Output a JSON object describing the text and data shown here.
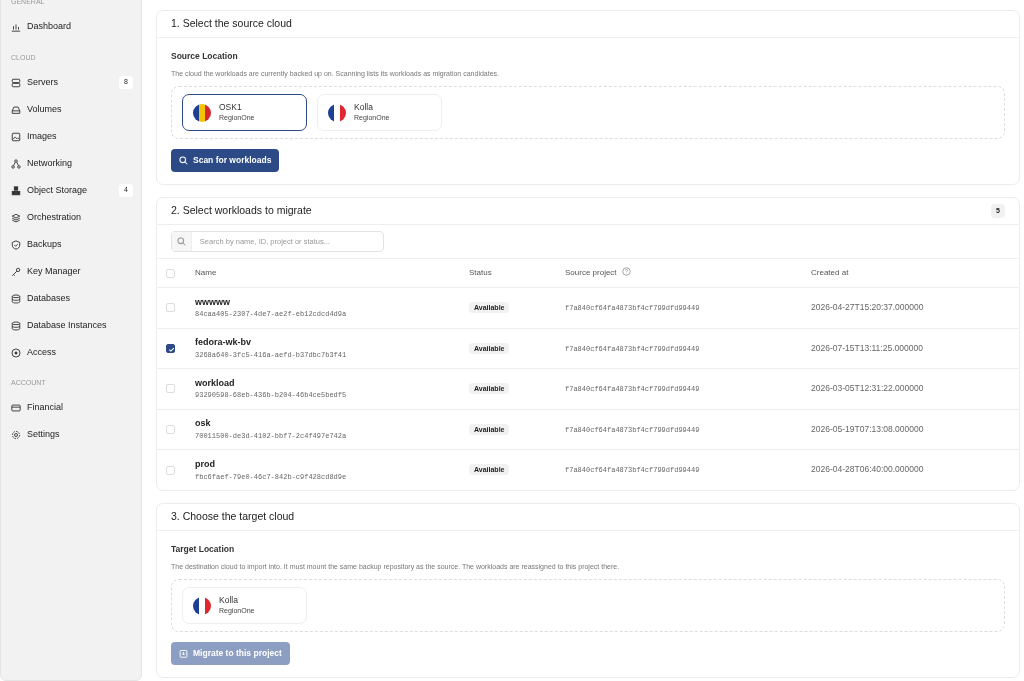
{
  "sidebar": {
    "sections": [
      {
        "title": "GENERAL",
        "items": [
          {
            "label": "Dashboard"
          }
        ]
      },
      {
        "title": "CLOUD",
        "items": [
          {
            "label": "Servers",
            "count": "8"
          },
          {
            "label": "Volumes"
          },
          {
            "label": "Images"
          },
          {
            "label": "Networking"
          },
          {
            "label": "Object Storage",
            "count": "4"
          },
          {
            "label": "Orchestration"
          },
          {
            "label": "Backups"
          },
          {
            "label": "Key Manager"
          },
          {
            "label": "Databases"
          },
          {
            "label": "Database Instances"
          },
          {
            "label": "Access"
          }
        ]
      },
      {
        "title": "ACCOUNT",
        "items": [
          {
            "label": "Financial"
          },
          {
            "label": "Settings"
          }
        ]
      }
    ]
  },
  "source": {
    "title": "1. Select the source cloud",
    "label": "Source Location",
    "help": "The cloud the workloads are currently backed up on. Scanning lists its workloads as migration candidates.",
    "locations": [
      {
        "name": "OSK1",
        "region": "RegionOne",
        "kind": "ro",
        "selected": true
      },
      {
        "name": "Kolla",
        "region": "RegionOne",
        "kind": "fr",
        "selected": false
      }
    ],
    "button": {
      "label": "Scan for workloads",
      "disabled": false
    }
  },
  "workloads": {
    "title": "2. Select workloads to migrate",
    "count": "5",
    "all_checked": false,
    "search": {
      "placeholder": "Search by name, ID, project or status..."
    },
    "columns": [
      "Name",
      "Status",
      "Source project",
      "Created at"
    ],
    "rows": [
      {
        "name": "wwwww",
        "id": "84caa405-2307-4de7-ae2f-eb12cdcd4d9a",
        "status": "Available",
        "project": "f7a840cf64fa4873bf4cf799dfd99449",
        "created": "2026-04-27T15:20:37.000000",
        "checked": false
      },
      {
        "name": "fedora-wk-bv",
        "id": "3268a640-3fc5-416a-aefd-b37dbc7b3f41",
        "status": "Available",
        "project": "f7a840cf64fa4873bf4cf799dfd99449",
        "created": "2026-07-15T13:11:25.000000",
        "checked": true
      },
      {
        "name": "workload",
        "id": "93290598-68eb-436b-b204-46b4ce5bedf5",
        "status": "Available",
        "project": "f7a840cf64fa4873bf4cf799dfd99449",
        "created": "2026-03-05T12:31:22.000000",
        "checked": false
      },
      {
        "name": "osk",
        "id": "70011500-de3d-4102-bbf7-2c4f497e742a",
        "status": "Available",
        "project": "f7a840cf64fa4873bf4cf799dfd99449",
        "created": "2026-05-19T07:13:08.000000",
        "checked": false
      },
      {
        "name": "prod",
        "id": "fbc6faef-79e0-46c7-842b-c9f428cd8d9e",
        "status": "Available",
        "project": "f7a840cf64fa4873bf4cf799dfd99449",
        "created": "2026-04-28T06:40:00.000000",
        "checked": false
      }
    ]
  },
  "target": {
    "title": "3. Choose the target cloud",
    "label": "Target Location",
    "help": "The destination cloud to import into. It must mount the same backup repository as the source. The workloads are reassigned to this project there.",
    "locations": [
      {
        "name": "Kolla",
        "region": "RegionOne",
        "kind": "fr",
        "selected": false
      }
    ],
    "button": {
      "label": "Migrate to this project",
      "disabled": true
    }
  }
}
